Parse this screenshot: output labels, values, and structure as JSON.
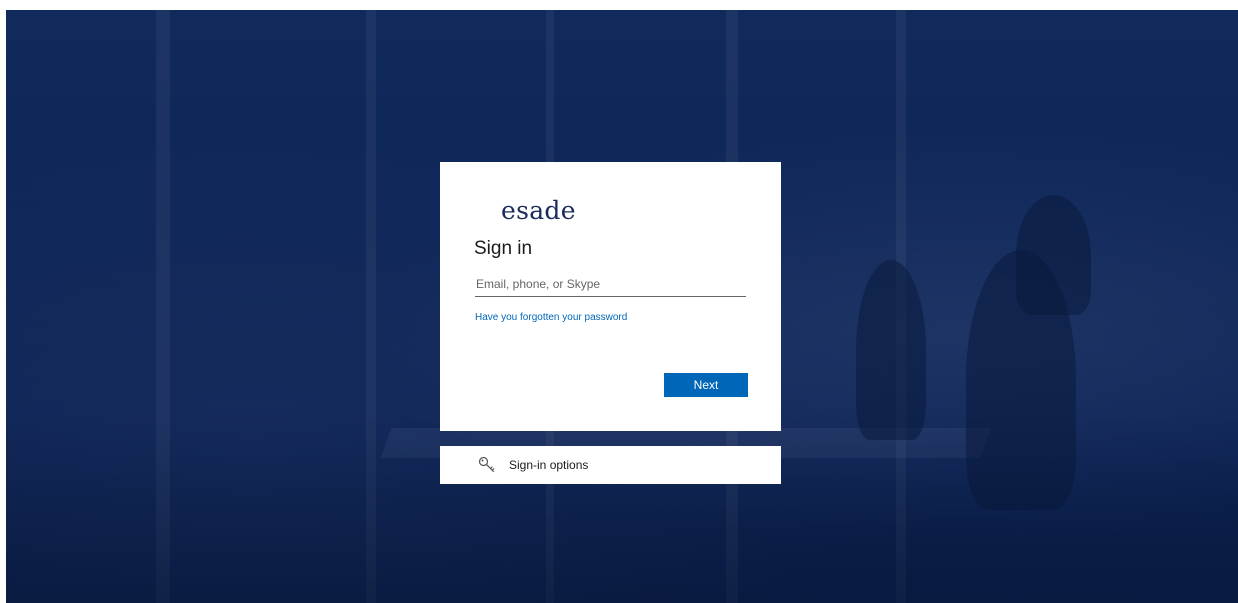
{
  "brand": {
    "logo_text": "esade",
    "background_color": "#0e2657",
    "accent_color": "#0067b8"
  },
  "login": {
    "title": "Sign in",
    "email": {
      "placeholder": "Email, phone, or Skype",
      "value": ""
    },
    "forgot_password_label": "Have you forgotten your password",
    "next_label": "Next"
  },
  "sign_in_options": {
    "icon": "key-icon",
    "label": "Sign-in options"
  }
}
